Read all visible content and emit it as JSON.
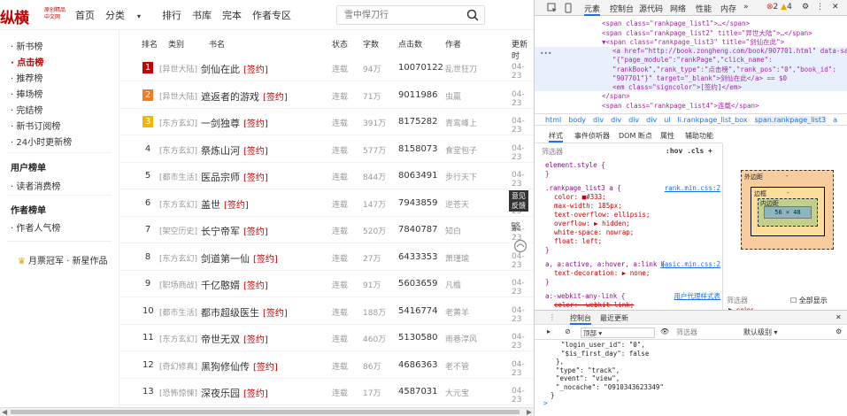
{
  "header": {
    "logo_main": "纵横",
    "logo_small": "原创精品中文网",
    "nav": [
      "首页",
      "分类",
      "排行",
      "书库",
      "完本",
      "作者专区"
    ],
    "search_placeholder": "雪中悍刀行"
  },
  "sidebar": {
    "items": [
      "新书榜",
      "点击榜",
      "推荐榜",
      "捧场榜",
      "完结榜",
      "新书订阅榜",
      "24小时更新榜"
    ],
    "active": "点击榜",
    "section_user": "用户榜单",
    "user_items": [
      "读者消费榜"
    ],
    "section_author": "作者榜单",
    "author_items": [
      "作者人气榜"
    ],
    "promo": "月票冠军 · 新星作品"
  },
  "table": {
    "headers": [
      "排名",
      "类别",
      "书名",
      "状态",
      "字数",
      "点击数",
      "作者",
      "更新时"
    ],
    "sign_label": "[签约]",
    "rows": [
      {
        "rank": "1",
        "cat": "[异世大陆]",
        "name": "剑仙在此",
        "signed": true,
        "status": "连载",
        "words": "94万",
        "clicks": "10070122",
        "author": "乱世狂刀",
        "date": "04-23"
      },
      {
        "rank": "2",
        "cat": "[异世大陆]",
        "name": "遮返者的游戏",
        "signed": true,
        "status": "连载",
        "words": "71万",
        "clicks": "9011986",
        "author": "虫羸",
        "date": "04-23"
      },
      {
        "rank": "3",
        "cat": "[东方玄幻]",
        "name": "一剑独尊",
        "signed": true,
        "status": "连载",
        "words": "391万",
        "clicks": "8175282",
        "author": "青鸾峰上",
        "date": "04-23"
      },
      {
        "rank": "4",
        "cat": "[东方玄幻]",
        "name": "祭炼山河",
        "signed": true,
        "status": "连载",
        "words": "577万",
        "clicks": "8158073",
        "author": "食堂包子",
        "date": "04-23"
      },
      {
        "rank": "5",
        "cat": "[都市生活]",
        "name": "医品宗师",
        "signed": true,
        "status": "连载",
        "words": "844万",
        "clicks": "8063491",
        "author": "步行天下",
        "date": "04-23"
      },
      {
        "rank": "6",
        "cat": "[东方玄幻]",
        "name": "盖世",
        "signed": true,
        "status": "连载",
        "words": "147万",
        "clicks": "7943859",
        "author": "逆苍天",
        "date": "04-23"
      },
      {
        "rank": "7",
        "cat": "[架空历史]",
        "name": "长宁帝军",
        "signed": true,
        "status": "连载",
        "words": "520万",
        "clicks": "7840787",
        "author": "知白",
        "date": "04-23"
      },
      {
        "rank": "8",
        "cat": "[东方玄幻]",
        "name": "剑道第一仙",
        "signed": true,
        "status": "连载",
        "words": "27万",
        "clicks": "6433353",
        "author": "萧瑾瑜",
        "date": "04-23"
      },
      {
        "rank": "9",
        "cat": "[职场商战]",
        "name": "千亿憨婿",
        "signed": true,
        "status": "连载",
        "words": "91万",
        "clicks": "5603659",
        "author": "凡檐",
        "date": "04-23"
      },
      {
        "rank": "10",
        "cat": "[都市生活]",
        "name": "都市超级医生",
        "signed": true,
        "status": "连载",
        "words": "188万",
        "clicks": "5416774",
        "author": "老黄羊",
        "date": "04-23"
      },
      {
        "rank": "11",
        "cat": "[东方玄幻]",
        "name": "帝世无双",
        "signed": true,
        "status": "连载",
        "words": "460万",
        "clicks": "5130580",
        "author": "雨巷淳风",
        "date": "04-23"
      },
      {
        "rank": "12",
        "cat": "[奇幻修真]",
        "name": "黑狗修仙传",
        "signed": true,
        "status": "连载",
        "words": "86万",
        "clicks": "4686363",
        "author": "老不管",
        "date": "04-23"
      },
      {
        "rank": "13",
        "cat": "[恐怖惊悚]",
        "name": "深夜乐园",
        "signed": true,
        "status": "连载",
        "words": "17万",
        "clicks": "4587031",
        "author": "大元宝",
        "date": "04-23"
      }
    ]
  },
  "floating": {
    "feedback": "意见反馈",
    "trad": "繁"
  },
  "devtools": {
    "tabs": [
      "元素",
      "控制台",
      "源代码",
      "网络",
      "性能",
      "内存"
    ],
    "more": "»",
    "errors": "2",
    "warnings": "4",
    "elements": [
      {
        "indent": 0,
        "html": "<span class=\"rankpage_list1\">…</span>"
      },
      {
        "indent": 0,
        "html": "<span class=\"rankpage_list2\" title=\"异世大陆\">…</span>"
      },
      {
        "indent": 0,
        "html": "▼<span class=\"rankpage_list3\" title=\"剑仙在此\">"
      },
      {
        "indent": 1,
        "html": "<a href=\"http://book.zongheng.com/book/907701.html\" data-sa-d="
      },
      {
        "indent": 1,
        "html": "\"{\"page_module\":\"rankPage\",\"click_name\":"
      },
      {
        "indent": 1,
        "html": "\"rankBook\",\"rank_type\":\"点击榜\",\"rank_pos\":\"0\",\"book_id\":"
      },
      {
        "indent": 1,
        "html": "\"907701\"}\" target=\"_blank\">剑仙在此</a> == $0"
      },
      {
        "indent": 1,
        "html": "<em class=\"signcolor\">[签约]</em>"
      },
      {
        "indent": 0,
        "html": "</span>"
      },
      {
        "indent": 0,
        "html": "<span class=\"rankpage_list4\">连载</span>"
      }
    ],
    "breadcrumbs": [
      "html",
      "body",
      "div",
      "div",
      "div",
      "div",
      "ul",
      "li.rankpage_list_box",
      "span.rankpage_list3",
      "a"
    ],
    "style_tabs": [
      "样式",
      "事件侦听器",
      "DOM 断点",
      "属性",
      "辅助功能"
    ],
    "filter_placeholder": "筛选器",
    "hov_cls": ":hov  .cls",
    "css": [
      {
        "sel": "element.style {",
        "lines": [
          "}"
        ],
        "src": ""
      },
      {
        "sel": ".rankpage_list3 a {",
        "lines": [
          "color: ■#333;",
          "max-width: 185px;",
          "text-overflow: ellipsis;",
          "overflow: ▶ hidden;",
          "white-space: nowrap;",
          "float: left;",
          "}"
        ],
        "src": "rank.min.css:2"
      },
      {
        "sel": "a, a:active, a:hover, a:link {",
        "lines": [
          "text-decoration: ▶ none;",
          "}"
        ],
        "src": "basic.min.css:2"
      },
      {
        "sel": "a:-webkit-any-link {",
        "lines": [
          "color: -webkit-link;",
          "cursor: pointer;"
        ],
        "src": "用户代理样式表"
      }
    ],
    "boxmodel": {
      "margin": "外边距",
      "border": "边框",
      "padding": "内边距",
      "content": "56 × 48",
      "dash": "-"
    },
    "filter2": "筛选器",
    "show_all": "全部显示",
    "color_prop": "▶ color",
    "console": {
      "tabs": [
        "控制台",
        "最近更新"
      ],
      "context": "顶部",
      "filter": "筛选器",
      "level": "默认级别",
      "lines": [
        "\"login_user_id\": \"0\",",
        "\"$is_first_day\": false",
        "},",
        "\"type\": \"track\",",
        "\"event\": \"view\",",
        "\"_nocache\": \"0910343623349\"",
        "}"
      ],
      "prompt": ">"
    }
  },
  "colors": {
    "accent": "#c40000",
    "rank1": "#c40000",
    "rank2": "#f47b20",
    "rank3": "#f4b400",
    "devblue": "#1a73e8"
  }
}
